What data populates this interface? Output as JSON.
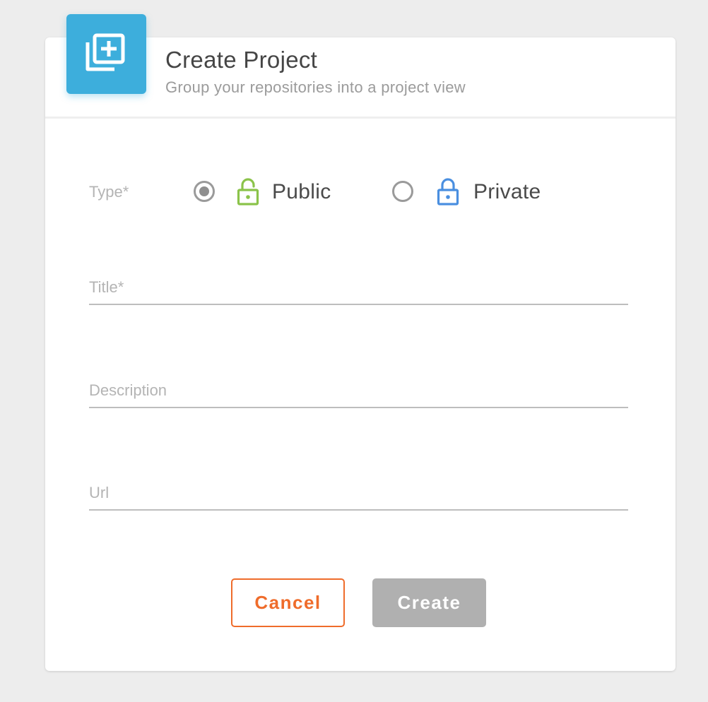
{
  "dialog": {
    "title": "Create Project",
    "subtitle": "Group your repositories into a project view",
    "header_icon": "library-add-icon",
    "accent_color": "#3daedc"
  },
  "type_field": {
    "label": "Type*",
    "options": [
      {
        "label": "Public",
        "icon": "unlocked-padlock-icon",
        "icon_color": "#8bc34a",
        "selected": true
      },
      {
        "label": "Private",
        "icon": "locked-padlock-icon",
        "icon_color": "#4a8fe0",
        "selected": false
      }
    ]
  },
  "fields": {
    "title": {
      "label": "Title*",
      "value": ""
    },
    "description": {
      "label": "Description",
      "value": ""
    },
    "url": {
      "label": "Url",
      "value": ""
    }
  },
  "actions": {
    "cancel_label": "Cancel",
    "cancel_color": "#ef6c2b",
    "create_label": "Create",
    "create_color": "#b0b0b0"
  }
}
